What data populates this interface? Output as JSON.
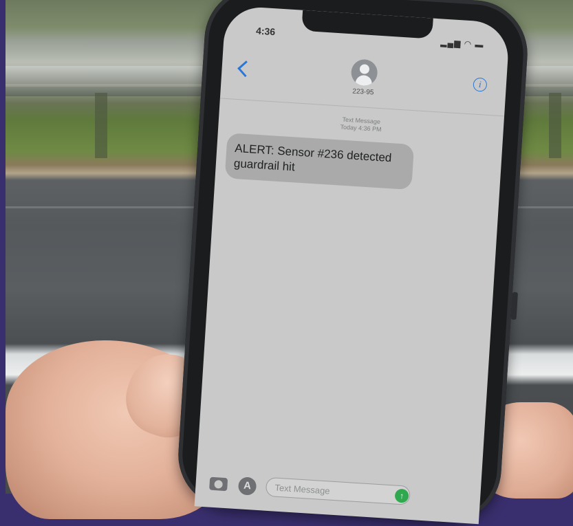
{
  "status_bar": {
    "time": "4:36",
    "icons": "▂▄▆ ◠ ▬"
  },
  "conversation": {
    "contact": "223-95",
    "header_line1": "Text Message",
    "header_line2": "Today 4:36 PM"
  },
  "messages": [
    {
      "text": "ALERT: Sensor #236 detected guardrail hit"
    }
  ],
  "composer": {
    "placeholder": "Text Message",
    "send_glyph": "↑",
    "appstore_glyph": "A"
  },
  "colors": {
    "accent": "#2a76d8",
    "send": "#2fa84f",
    "bubble": "#a9aaa9"
  }
}
